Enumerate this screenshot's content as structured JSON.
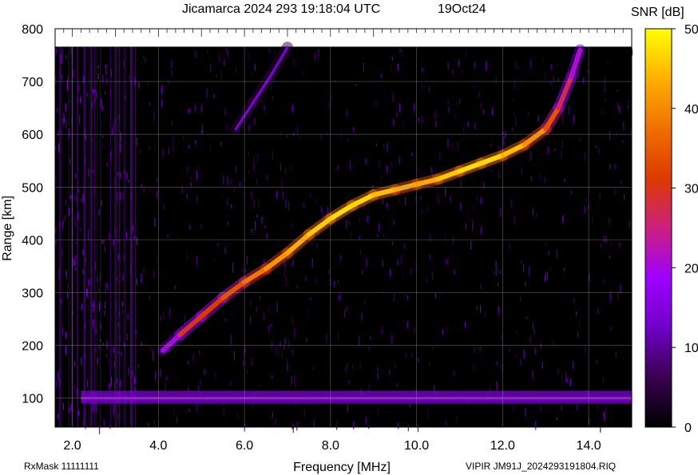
{
  "header": {
    "title": "Jicamarca 2024 293 19:18:04 UTC",
    "date": "19Oct24"
  },
  "footer": {
    "rxmask": "RxMask 11111111",
    "file": "VIPIR  JM91J_2024293191804.RIQ"
  },
  "chart_data": {
    "type": "heatmap",
    "title": "Jicamarca 2024 293 19:18:04 UTC",
    "xlabel": "Frequency [MHz]",
    "ylabel": "Range [km]",
    "xlim": [
      1.6,
      15.0
    ],
    "ylim": [
      45,
      800
    ],
    "xticks": [
      "2.0",
      "4.0",
      "6.0",
      "8.0",
      "10.0",
      "12.0",
      "14.0"
    ],
    "yticks": [
      "100",
      "200",
      "300",
      "400",
      "500",
      "600",
      "700",
      "800"
    ],
    "grid": true,
    "colorbar": {
      "label": "SNR [dB]",
      "range": [
        0,
        50
      ],
      "ticks": [
        "0",
        "10",
        "20",
        "30",
        "40",
        "50"
      ],
      "colors": [
        "#000000",
        "#3a0050",
        "#7000c8",
        "#a000ff",
        "#cc2080",
        "#dd3a00",
        "#f07000",
        "#ffb000",
        "#ffff00"
      ]
    },
    "series": [
      {
        "x": [
          4.1,
          4.5,
          5.0,
          5.5,
          6.0,
          6.5,
          7.0,
          7.5,
          8.0,
          8.5,
          9.0,
          9.5,
          10.0,
          10.5,
          11.0,
          11.5,
          12.0,
          12.5,
          13.0,
          13.3,
          13.6,
          13.8
        ],
        "y": [
          190,
          220,
          255,
          290,
          320,
          345,
          375,
          410,
          440,
          465,
          485,
          495,
          505,
          515,
          530,
          545,
          560,
          580,
          610,
          650,
          710,
          760
        ],
        "snr": [
          12,
          28,
          30,
          32,
          36,
          40,
          42,
          45,
          47,
          48,
          46,
          44,
          42,
          44,
          47,
          48,
          46,
          44,
          38,
          30,
          24,
          18
        ]
      },
      {
        "x": [
          5.8,
          6.2,
          6.6,
          7.0
        ],
        "y": [
          610,
          660,
          710,
          765
        ],
        "snr": [
          14,
          15,
          15,
          14
        ]
      }
    ],
    "e_layer": {
      "range_km": 100,
      "x_range": [
        2.2,
        15.0
      ],
      "snr": 14
    }
  }
}
